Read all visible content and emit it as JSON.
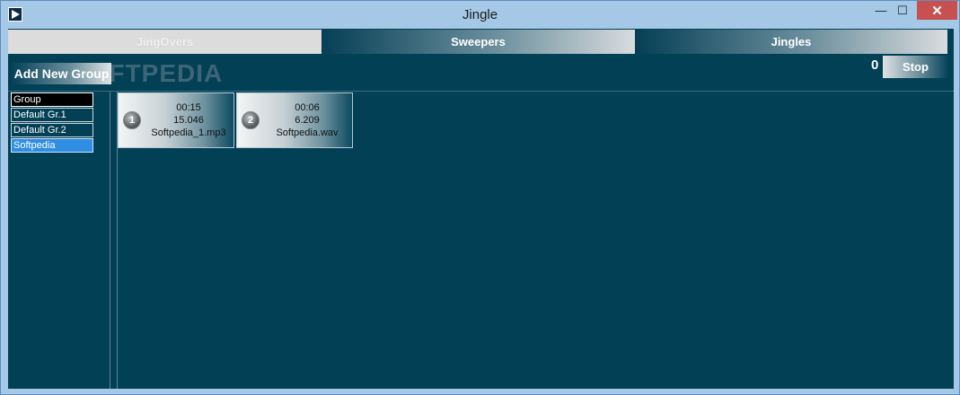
{
  "window": {
    "title": "Jingle"
  },
  "titlebar_buttons": {
    "minimize": "—",
    "maximize": "☐",
    "close": "✕"
  },
  "tabs": [
    {
      "label": "JingOvers",
      "active": true
    },
    {
      "label": "Sweepers",
      "active": false
    },
    {
      "label": "Jingles",
      "active": false
    }
  ],
  "watermark": "SOFTPEDIA",
  "toolbar": {
    "add_group_label": "Add New Group",
    "counter": "0",
    "stop_label": "Stop"
  },
  "groups": {
    "header": "Group",
    "items": [
      {
        "label": "Default Gr.1",
        "selected": false
      },
      {
        "label": "Default Gr.2",
        "selected": false
      },
      {
        "label": "Softpedia",
        "selected": true
      }
    ]
  },
  "jingles": [
    {
      "number": "1",
      "duration": "00:15",
      "size": "15.046",
      "file": "Softpedia_1.mp3"
    },
    {
      "number": "2",
      "duration": "00:06",
      "size": "6.209",
      "file": "Softpedia.wav"
    }
  ],
  "colors": {
    "background": "#024056",
    "selected": "#2f8ee3",
    "close_button": "#c75050"
  }
}
